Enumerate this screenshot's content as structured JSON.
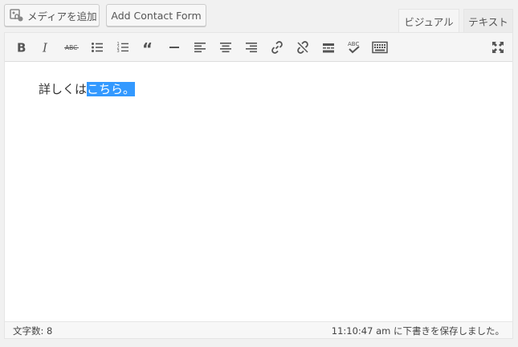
{
  "buttons": {
    "add_media": "メディアを追加",
    "add_contact_form": "Add Contact Form"
  },
  "tabs": {
    "visual": "ビジュアル",
    "text": "テキスト"
  },
  "toolbar": {
    "items": [
      {
        "name": "bold",
        "icon": "bold-icon"
      },
      {
        "name": "italic",
        "icon": "italic-icon"
      },
      {
        "name": "strikethrough",
        "icon": "strikethrough-icon",
        "glyph": "ABC"
      },
      {
        "name": "bulleted-list",
        "icon": "bulleted-list-icon"
      },
      {
        "name": "numbered-list",
        "icon": "numbered-list-icon"
      },
      {
        "name": "blockquote",
        "icon": "blockquote-icon"
      },
      {
        "name": "horizontal-line",
        "icon": "horizontal-line-icon"
      },
      {
        "name": "align-left",
        "icon": "align-left-icon"
      },
      {
        "name": "align-center",
        "icon": "align-center-icon"
      },
      {
        "name": "align-right",
        "icon": "align-right-icon"
      },
      {
        "name": "insert-link",
        "icon": "link-icon"
      },
      {
        "name": "remove-link",
        "icon": "unlink-icon"
      },
      {
        "name": "read-more",
        "icon": "read-more-icon"
      },
      {
        "name": "spellcheck",
        "icon": "spellcheck-icon",
        "glyph": "ABC"
      },
      {
        "name": "toolbar-toggle",
        "icon": "keyboard-icon"
      },
      {
        "name": "fullscreen",
        "icon": "fullscreen-icon"
      }
    ]
  },
  "content": {
    "text_before": "詳しくは",
    "text_selected": "こちら。"
  },
  "status": {
    "word_count": "文字数: 8",
    "autosave": "11:10:47 am に下書きを保存しました。"
  },
  "colors": {
    "selection": "#3399ff",
    "toolbar_bg": "#f5f5f5",
    "icon": "#555555"
  }
}
